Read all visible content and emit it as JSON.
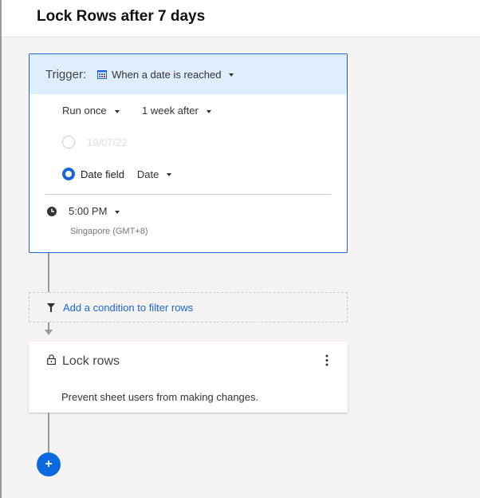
{
  "header": {
    "title": "Lock Rows after 7 days"
  },
  "trigger": {
    "label": "Trigger:",
    "type": "When a date is reached",
    "frequency": "Run once",
    "offset": "1 week after",
    "date_value": "19/07/22",
    "date_field_label": "Date field",
    "date_field": "Date",
    "time": "5:00 PM",
    "timezone": "Singapore (GMT+8)"
  },
  "filter": {
    "link": "Add a condition to filter rows"
  },
  "action": {
    "title": "Lock rows",
    "description": "Prevent sheet users from making changes."
  },
  "add_button": {
    "label": "+"
  },
  "colors": {
    "accent": "#1a66d8",
    "trigger_bg": "#dfeefd"
  }
}
